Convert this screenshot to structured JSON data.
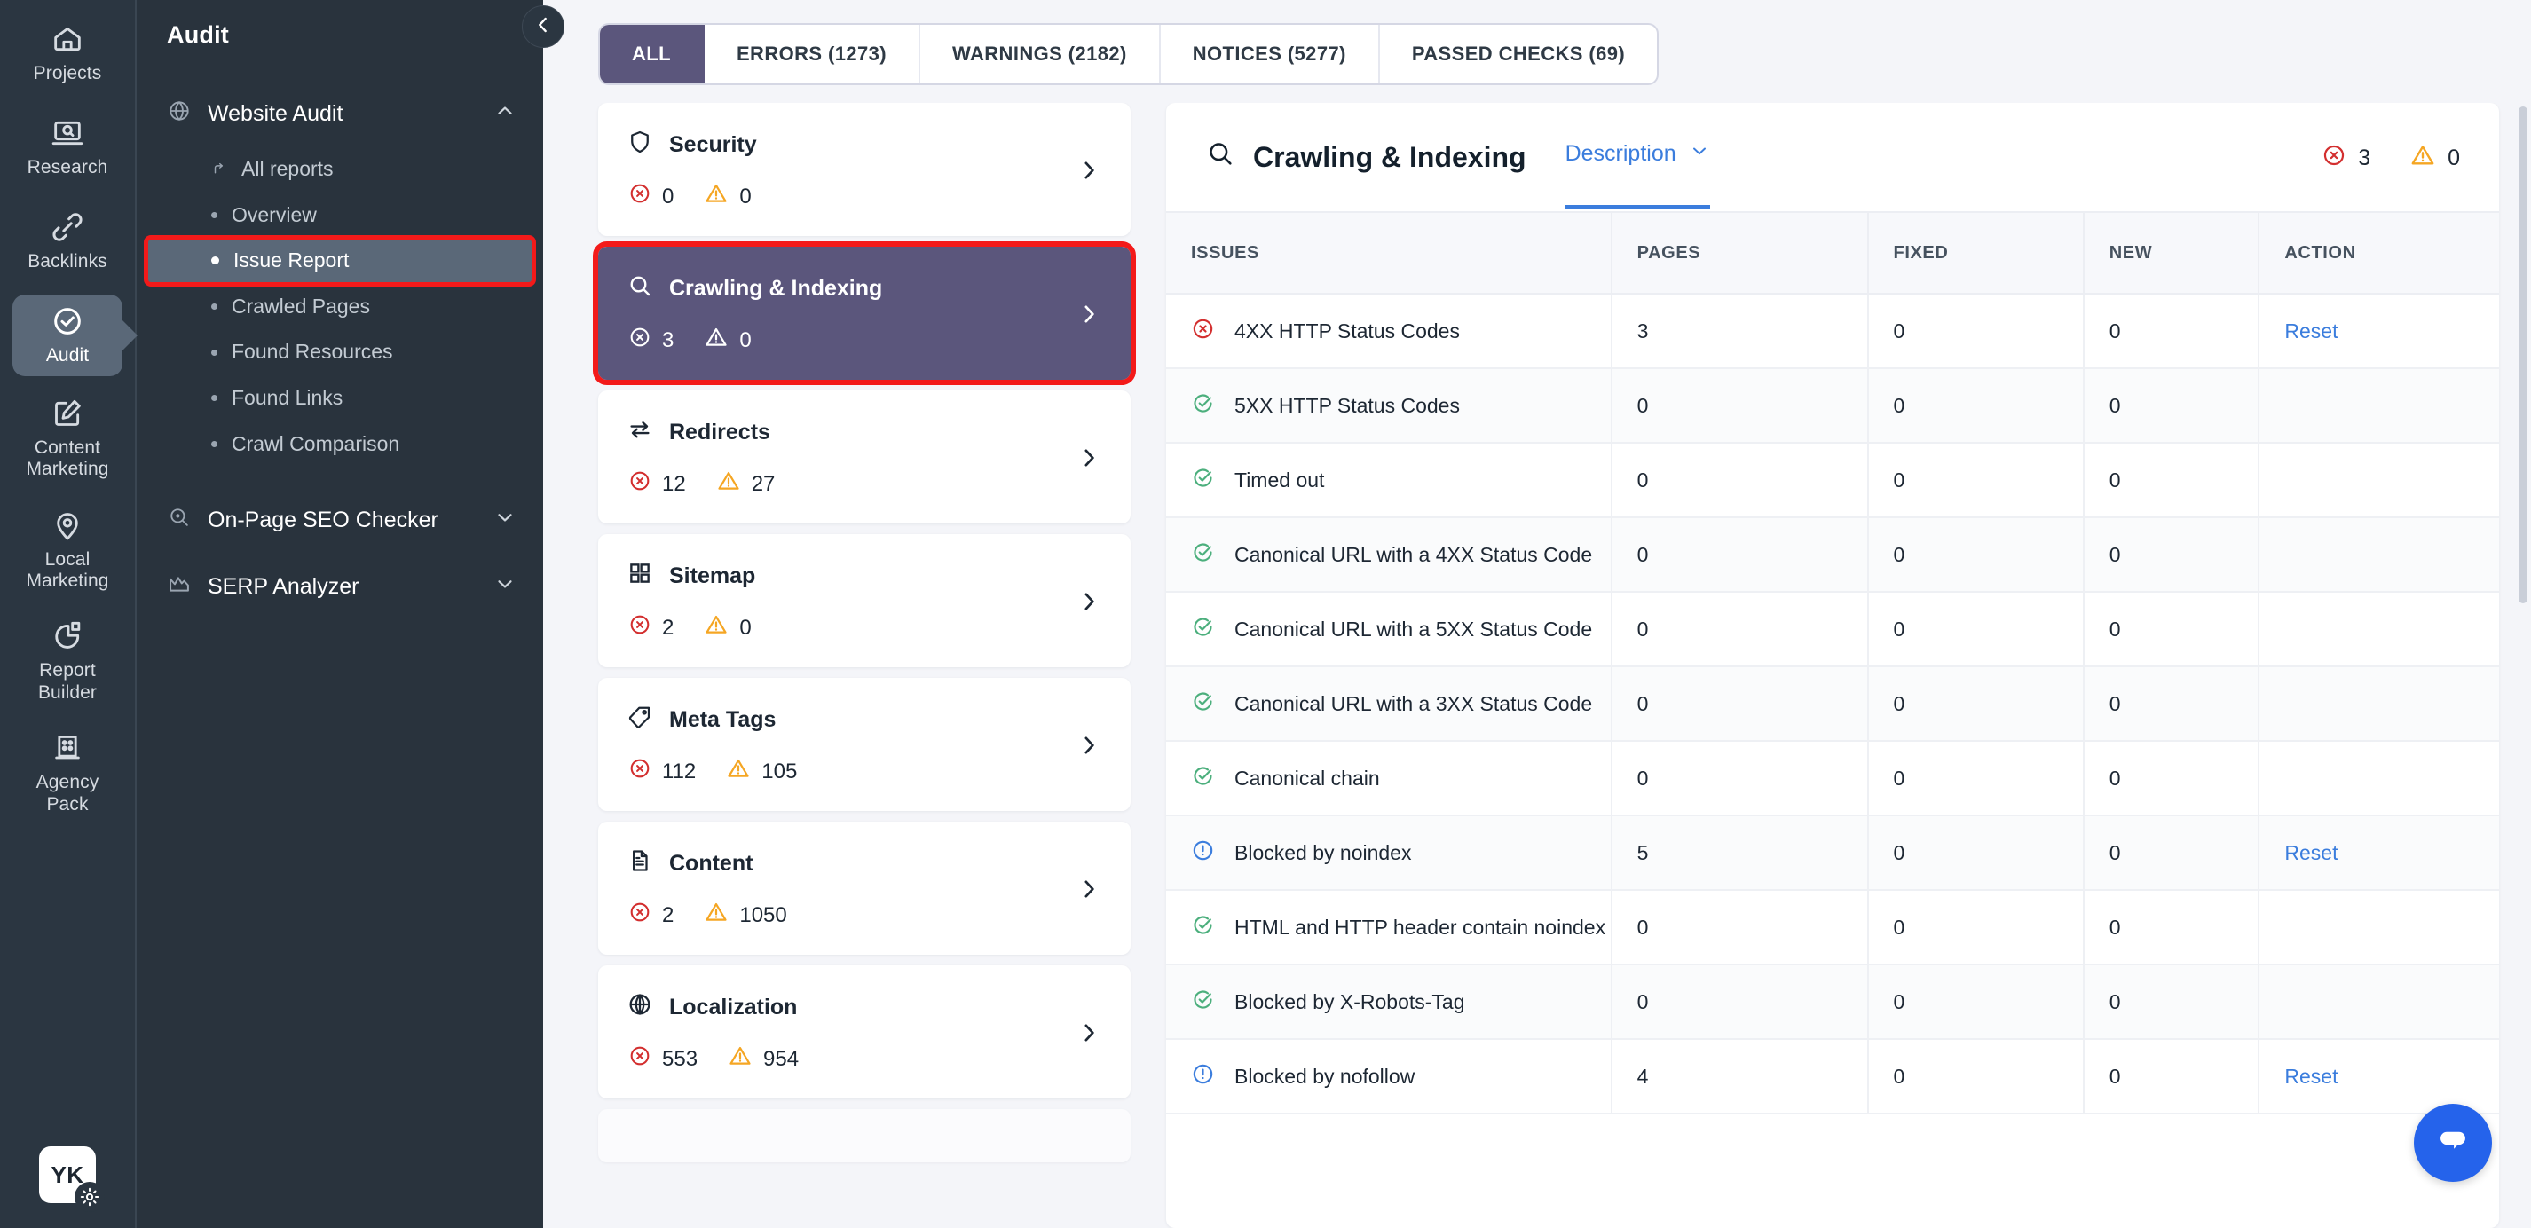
{
  "rail": {
    "items": [
      {
        "label": "Projects",
        "icon": "home-icon",
        "active": false
      },
      {
        "label": "Research",
        "icon": "research-laptop-icon",
        "active": false
      },
      {
        "label": "Backlinks",
        "icon": "link-icon",
        "active": false
      },
      {
        "label": "Audit",
        "icon": "check-circle-icon",
        "active": true
      },
      {
        "label": "Content Marketing",
        "icon": "edit-square-icon",
        "active": false
      },
      {
        "label": "Local Marketing",
        "icon": "map-pin-icon",
        "active": false
      },
      {
        "label": "Report Builder",
        "icon": "pie-chart-icon",
        "active": false
      },
      {
        "label": "Agency Pack",
        "icon": "building-icon",
        "active": false
      }
    ],
    "avatar_initials": "YK"
  },
  "sidebar": {
    "title": "Audit",
    "collapse_icon": "chevron-left-icon",
    "groups": [
      {
        "label": "Website Audit",
        "icon": "globe-icon",
        "chevron": "chevron-up-icon",
        "items": [
          {
            "label": "All reports",
            "marker": "return-arrow-icon",
            "active": false,
            "highlight": false
          },
          {
            "label": "Overview",
            "marker": "dot",
            "active": false,
            "highlight": false
          },
          {
            "label": "Issue Report",
            "marker": "dot",
            "active": true,
            "highlight": true
          },
          {
            "label": "Crawled Pages",
            "marker": "dot",
            "active": false,
            "highlight": false
          },
          {
            "label": "Found Resources",
            "marker": "dot",
            "active": false,
            "highlight": false
          },
          {
            "label": "Found Links",
            "marker": "dot",
            "active": false,
            "highlight": false
          },
          {
            "label": "Crawl Comparison",
            "marker": "dot",
            "active": false,
            "highlight": false
          }
        ]
      },
      {
        "label": "On-Page SEO Checker",
        "icon": "magnifier-dot-icon",
        "chevron": "chevron-down-icon",
        "items": []
      },
      {
        "label": "SERP Analyzer",
        "icon": "mountain-chart-icon",
        "chevron": "chevron-down-icon",
        "items": []
      }
    ]
  },
  "tabs": [
    {
      "label": "ALL",
      "active": true
    },
    {
      "label": "ERRORS (1273)",
      "active": false
    },
    {
      "label": "WARNINGS (2182)",
      "active": false
    },
    {
      "label": "NOTICES (5277)",
      "active": false
    },
    {
      "label": "PASSED CHECKS (69)",
      "active": false
    }
  ],
  "categories": [
    {
      "title": "Security",
      "icon": "shield-icon",
      "errors": "0",
      "warnings": "0",
      "selected": false,
      "highlight": false
    },
    {
      "title": "Crawling & Indexing",
      "icon": "magnifier-icon",
      "errors": "3",
      "warnings": "0",
      "selected": true,
      "highlight": true
    },
    {
      "title": "Redirects",
      "icon": "redirect-loop-icon",
      "errors": "12",
      "warnings": "27",
      "selected": false,
      "highlight": false
    },
    {
      "title": "Sitemap",
      "icon": "grid-icon",
      "errors": "2",
      "warnings": "0",
      "selected": false,
      "highlight": false
    },
    {
      "title": "Meta Tags",
      "icon": "tag-icon",
      "errors": "112",
      "warnings": "105",
      "selected": false,
      "highlight": false
    },
    {
      "title": "Content",
      "icon": "document-icon",
      "errors": "2",
      "warnings": "1050",
      "selected": false,
      "highlight": false
    },
    {
      "title": "Localization",
      "icon": "globe-icon",
      "errors": "553",
      "warnings": "954",
      "selected": false,
      "highlight": false
    }
  ],
  "panel": {
    "title": "Crawling & Indexing",
    "title_icon": "magnifier-icon",
    "description_tab": "Description",
    "description_chevron": "chevron-down-icon",
    "error_count": "3",
    "warning_count": "0",
    "columns": [
      "ISSUES",
      "PAGES",
      "FIXED",
      "NEW",
      "ACTION"
    ],
    "rows": [
      {
        "status": "error",
        "issue": "4XX HTTP Status Codes",
        "pages": "3",
        "fixed": "0",
        "new": "0",
        "action": "Reset"
      },
      {
        "status": "passed",
        "issue": "5XX HTTP Status Codes",
        "pages": "0",
        "fixed": "0",
        "new": "0",
        "action": ""
      },
      {
        "status": "passed",
        "issue": "Timed out",
        "pages": "0",
        "fixed": "0",
        "new": "0",
        "action": ""
      },
      {
        "status": "passed",
        "issue": "Canonical URL with a 4XX Status Code",
        "pages": "0",
        "fixed": "0",
        "new": "0",
        "action": ""
      },
      {
        "status": "passed",
        "issue": "Canonical URL with a 5XX Status Code",
        "pages": "0",
        "fixed": "0",
        "new": "0",
        "action": ""
      },
      {
        "status": "passed",
        "issue": "Canonical URL with a 3XX Status Code",
        "pages": "0",
        "fixed": "0",
        "new": "0",
        "action": ""
      },
      {
        "status": "passed",
        "issue": "Canonical chain",
        "pages": "0",
        "fixed": "0",
        "new": "0",
        "action": ""
      },
      {
        "status": "notice",
        "issue": "Blocked by noindex",
        "pages": "5",
        "fixed": "0",
        "new": "0",
        "action": "Reset"
      },
      {
        "status": "passed",
        "issue": "HTML and HTTP header contain noindex",
        "pages": "0",
        "fixed": "0",
        "new": "0",
        "action": ""
      },
      {
        "status": "passed",
        "issue": "Blocked by X-Robots-Tag",
        "pages": "0",
        "fixed": "0",
        "new": "0",
        "action": ""
      },
      {
        "status": "notice",
        "issue": "Blocked by nofollow",
        "pages": "4",
        "fixed": "0",
        "new": "0",
        "action": "Reset"
      }
    ]
  },
  "chat": {
    "icon": "chat-bubble-icon"
  },
  "colors": {
    "accent_purple": "#5b567c",
    "rail_bg": "#2b3641",
    "sidebar_bg": "#29333d",
    "link_blue": "#3b7ddd",
    "error_red": "#d32f2f",
    "warning_amber": "#f5a623",
    "passed_green": "#4caf7d",
    "notice_blue": "#3b7ddd",
    "highlight_red": "#f31a1a",
    "chat_blue": "#2563eb"
  }
}
